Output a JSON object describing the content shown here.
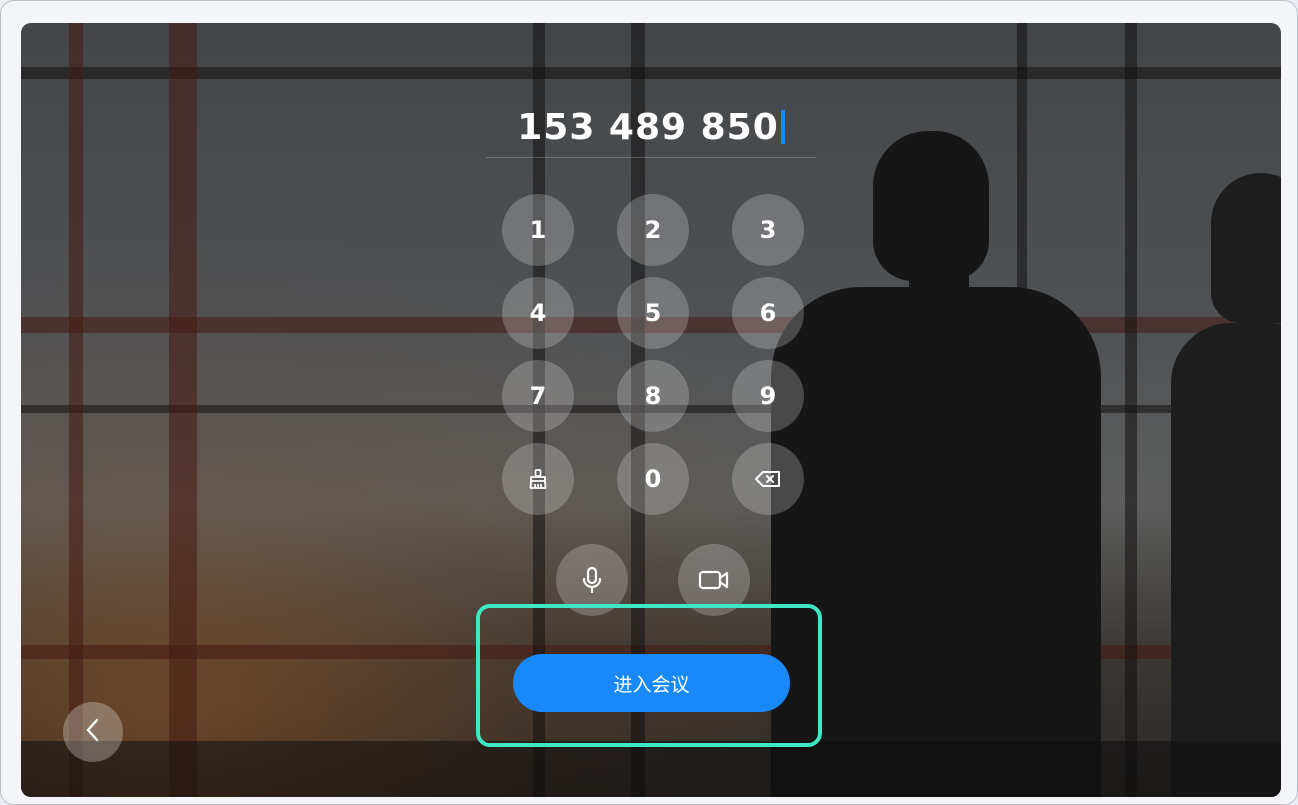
{
  "dialer": {
    "meeting_number": "153 489 850",
    "keys": [
      "1",
      "2",
      "3",
      "4",
      "5",
      "6",
      "7",
      "8",
      "9",
      "0"
    ]
  },
  "icons": {
    "clear": "broom-icon",
    "delete": "backspace-icon",
    "microphone": "microphone-icon",
    "camera": "video-camera-icon",
    "back": "chevron-left-icon"
  },
  "join": {
    "label": "进入会议"
  },
  "colors": {
    "accent": "#1989fa",
    "caret": "#1e86ff",
    "highlight": "#3ee8c4"
  }
}
